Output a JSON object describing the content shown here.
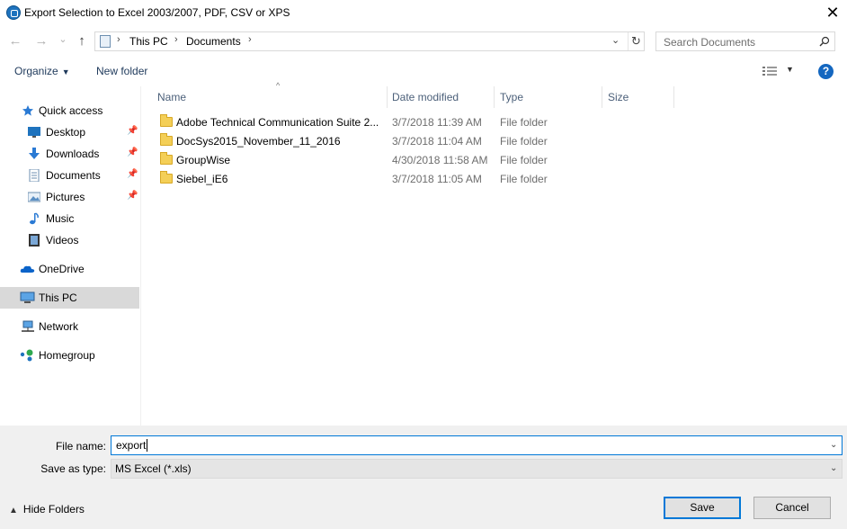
{
  "window": {
    "title": "Export Selection to Excel 2003/2007, PDF, CSV or XPS",
    "close_glyph": "✕"
  },
  "nav": {
    "back_glyph": "←",
    "forward_glyph": "→",
    "recent_glyph": "⌄",
    "up_glyph": "↑",
    "address_segments": [
      "This PC",
      "Documents"
    ],
    "search_placeholder": "Search Documents"
  },
  "toolbar": {
    "organize_label": "Organize",
    "new_folder_label": "New folder",
    "help_glyph": "?"
  },
  "sidebar": {
    "items": [
      {
        "label": "Quick access",
        "icon": "star-icon"
      },
      {
        "label": "Desktop",
        "icon": "desktop-icon",
        "pinned": true
      },
      {
        "label": "Downloads",
        "icon": "download-icon",
        "pinned": true
      },
      {
        "label": "Documents",
        "icon": "documents-icon",
        "pinned": true
      },
      {
        "label": "Pictures",
        "icon": "pictures-icon",
        "pinned": true
      },
      {
        "label": "Music",
        "icon": "music-icon"
      },
      {
        "label": "Videos",
        "icon": "videos-icon"
      },
      {
        "label": "OneDrive",
        "icon": "cloud-icon"
      },
      {
        "label": "This PC",
        "icon": "computer-icon",
        "selected": true
      },
      {
        "label": "Network",
        "icon": "network-icon"
      },
      {
        "label": "Homegroup",
        "icon": "homegroup-icon"
      }
    ]
  },
  "files": {
    "columns": [
      "Name",
      "Date modified",
      "Type",
      "Size"
    ],
    "rows": [
      {
        "name": "Adobe Technical Communication Suite 2...",
        "date": "3/7/2018 11:39 AM",
        "type": "File folder",
        "size": ""
      },
      {
        "name": "DocSys2015_November_11_2016",
        "date": "3/7/2018 11:04 AM",
        "type": "File folder",
        "size": ""
      },
      {
        "name": "GroupWise",
        "date": "4/30/2018 11:58 AM",
        "type": "File folder",
        "size": ""
      },
      {
        "name": "Siebel_iE6",
        "date": "3/7/2018 11:05 AM",
        "type": "File folder",
        "size": ""
      }
    ]
  },
  "save": {
    "file_name_label": "File name:",
    "file_name_value": "export",
    "save_as_type_label": "Save as type:",
    "save_as_type_value": "MS Excel (*.xls)",
    "hide_folders_label": "Hide Folders",
    "save_button": "Save",
    "cancel_button": "Cancel"
  },
  "colors": {
    "accent": "#0078d7",
    "selected_bg": "#d9d9d9",
    "bottom_bg": "#f0f0f0"
  }
}
